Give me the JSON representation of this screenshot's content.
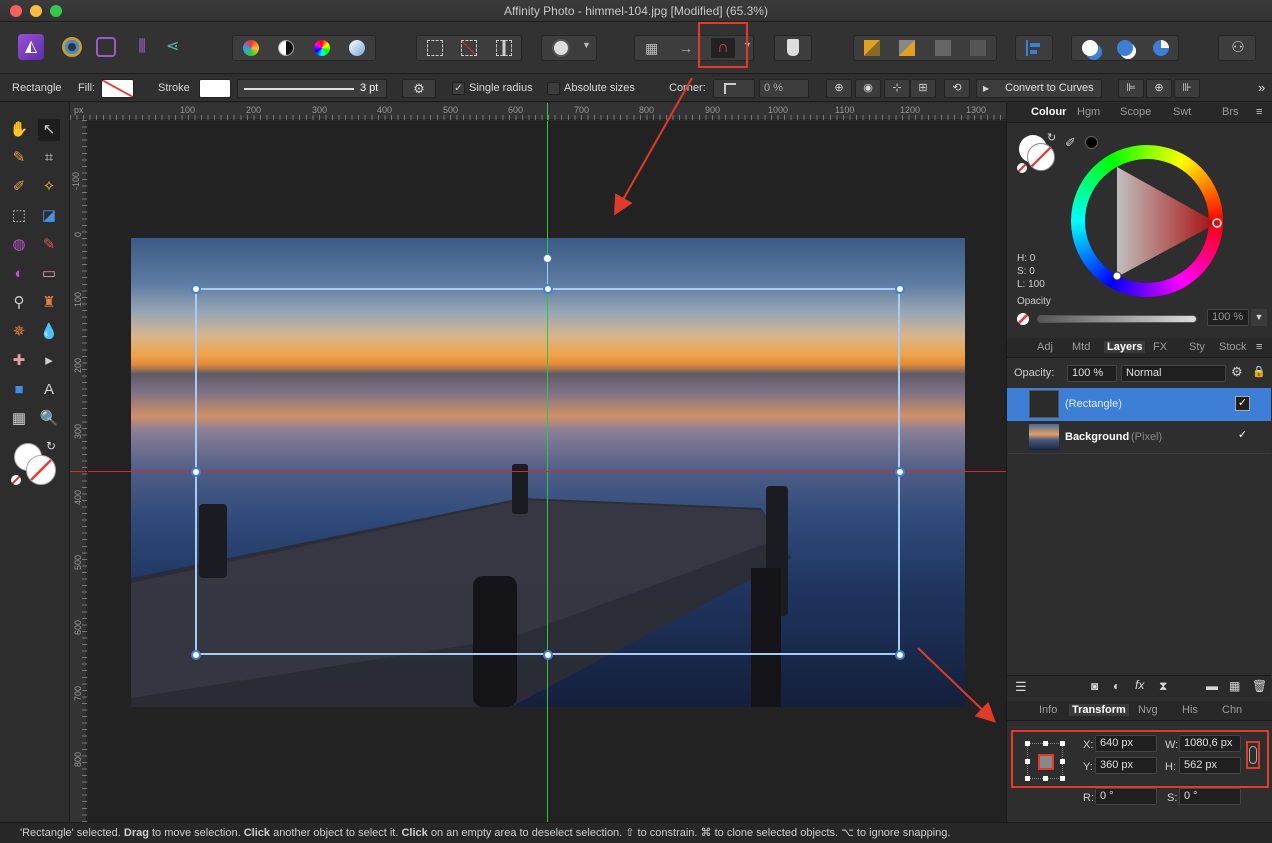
{
  "window": {
    "title": "Affinity Photo - himmel-104.jpg [Modified] (65.3%)"
  },
  "context_bar": {
    "tool": "Rectangle",
    "fill_label": "Fill:",
    "stroke_label": "Stroke",
    "stroke_width": "3 pt",
    "single_radius": "Single radius",
    "absolute_sizes": "Absolute sizes",
    "corner_label": "Corner:",
    "corner_value": "0 %",
    "convert_to_curves": "Convert to Curves"
  },
  "ruler": {
    "unit": "px",
    "h_ticks": [
      "100",
      "200",
      "300",
      "400",
      "500",
      "600",
      "700",
      "800",
      "900",
      "1000",
      "1100",
      "1200",
      "1300"
    ],
    "v_ticks": [
      "-100",
      "0",
      "100",
      "200",
      "300",
      "400",
      "500",
      "600",
      "700",
      "800"
    ]
  },
  "colour_panel": {
    "tabs": [
      "Colour",
      "Hgm",
      "Scope",
      "Swt",
      "Brs"
    ],
    "h": "H: 0",
    "s": "S: 0",
    "l": "L: 100",
    "opacity_label": "Opacity",
    "opacity_value": "100 %"
  },
  "layers_panel": {
    "tabs": [
      "Adj",
      "Mtd",
      "Layers",
      "FX",
      "Sty",
      "Stock"
    ],
    "opacity_label": "Opacity:",
    "opacity_value": "100 %",
    "blend_mode": "Normal",
    "layers": [
      {
        "name": "(Rectangle)",
        "type": "",
        "checked": "✓"
      },
      {
        "name": "Background",
        "type": "(Pixel)",
        "checked": "✓"
      }
    ]
  },
  "transform_panel": {
    "tabs": [
      "Info",
      "Transform",
      "Nvg",
      "His",
      "Chn"
    ],
    "x_label": "X:",
    "x": "640 px",
    "y_label": "Y:",
    "y": "360 px",
    "w_label": "W:",
    "w": "1080,6 px",
    "h_label": "H:",
    "h": "562 px",
    "r_label": "R:",
    "r": "0 °",
    "s_label": "S:",
    "s": "0 °"
  },
  "status": {
    "t1": "'Rectangle' selected. ",
    "b1": "Drag",
    "t2": " to move selection. ",
    "b2": "Click",
    "t3": " another object to select it. ",
    "b3": "Click",
    "t4": " on an empty area to deselect selection. ⇧ to constrain. ⌘ to clone selected objects. ⌥ to ignore snapping."
  },
  "colors": {
    "accent": "#4a90e2",
    "annotation": "#e03a2a",
    "guide_green": "#33c244",
    "guide_red": "#d42a2a",
    "layer_selected": "#3d7fd6"
  }
}
